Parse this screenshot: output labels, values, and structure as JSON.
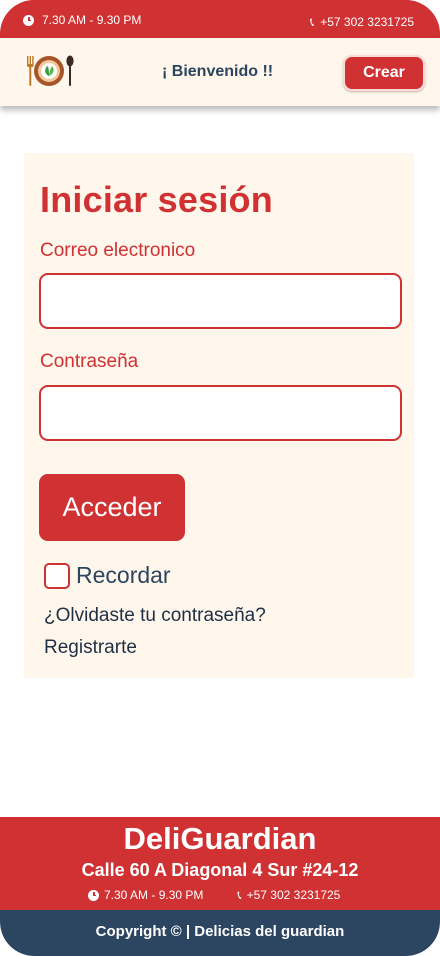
{
  "topbar": {
    "hours": "7.30 AM - 9.30 PM",
    "phone": "+57 302 3231725"
  },
  "header": {
    "logo_icon": "plate-fork-spoon-logo",
    "welcome": "¡ Bienvenido !!",
    "create_label": "Crear"
  },
  "login": {
    "title": "Iniciar sesión",
    "email_label": "Correo electronico",
    "email_value": "",
    "password_label": "Contraseña",
    "password_value": "",
    "submit_label": "Acceder",
    "remember_label": "Recordar",
    "remember_checked": false,
    "forgot_label": "¿Olvidaste tu contraseña?",
    "register_label": "Registrarte"
  },
  "footer": {
    "brand": "DeliGuardian",
    "address": "Calle 60 A Diagonal 4 Sur #24-12",
    "hours": "7.30 AM - 9.30 PM",
    "phone": "+57 302 3231725",
    "copyright": "Copyright ©  | Delicias del guardian"
  },
  "colors": {
    "primary_red": "#d03133",
    "navy": "#2c4560",
    "cream": "#fff7ec"
  }
}
